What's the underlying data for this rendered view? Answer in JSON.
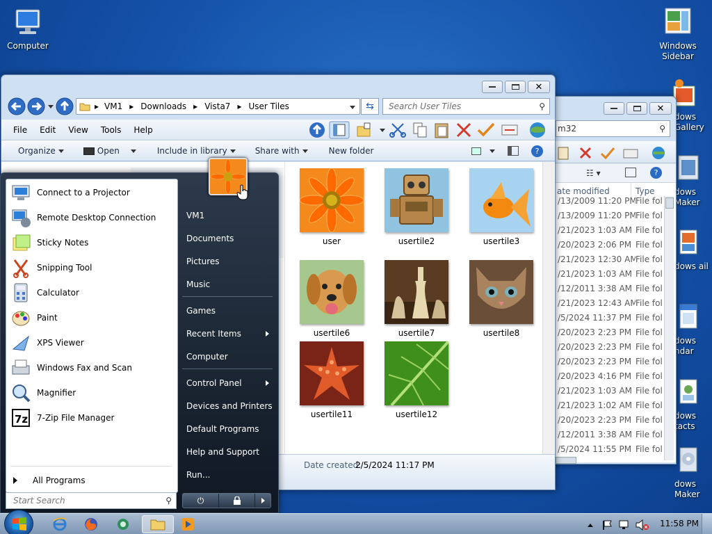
{
  "desktop": {
    "icons": [
      {
        "label": "Computer"
      },
      {
        "label": "Windows Sidebar"
      },
      {
        "label": "dows Gallery"
      },
      {
        "label": "dows Maker"
      },
      {
        "label": "dows ail"
      },
      {
        "label": "dows ndar"
      },
      {
        "label": "dows tacts"
      },
      {
        "label": "dows Maker"
      }
    ]
  },
  "back_window": {
    "address_fragment": "m32",
    "columns": [
      "ate modified",
      "Type"
    ],
    "rows": [
      {
        "date": "/13/2009 11:20 PM",
        "type": "File fol"
      },
      {
        "date": "/13/2009 11:20 PM",
        "type": "File fol"
      },
      {
        "date": "/21/2023 1:03 AM",
        "type": "File fol"
      },
      {
        "date": "/20/2023 2:06 PM",
        "type": "File fol"
      },
      {
        "date": "/21/2023 12:30 AM",
        "type": "File fol"
      },
      {
        "date": "/21/2023 1:03 AM",
        "type": "File fol"
      },
      {
        "date": "/12/2011 3:38 AM",
        "type": "File fol"
      },
      {
        "date": "/21/2023 12:43 AM",
        "type": "File fol"
      },
      {
        "date": "/5/2024 11:37 PM",
        "type": "File fol"
      },
      {
        "date": "/20/2023 2:23 PM",
        "type": "File fol"
      },
      {
        "date": "/20/2023 2:23 PM",
        "type": "File fol"
      },
      {
        "date": "/20/2023 2:23 PM",
        "type": "File fol"
      },
      {
        "date": "/20/2023 4:16 PM",
        "type": "File fol"
      },
      {
        "date": "/21/2023 1:03 AM",
        "type": "File fol"
      },
      {
        "date": "/21/2023 1:02 AM",
        "type": "File fol"
      },
      {
        "date": "/20/2023 2:23 PM",
        "type": "File fol"
      },
      {
        "date": "/12/2011 3:38 AM",
        "type": "File fol"
      },
      {
        "date": "/5/2024 11:55 PM",
        "type": "File fol"
      }
    ]
  },
  "explorer": {
    "breadcrumb": [
      "VM1",
      "Downloads",
      "Vista7",
      "User Tiles"
    ],
    "search_placeholder": "Search User Tiles",
    "menu": [
      "File",
      "Edit",
      "View",
      "Tools",
      "Help"
    ],
    "commands": {
      "organize": "Organize",
      "open": "Open",
      "include": "Include in library",
      "share": "Share with",
      "new_folder": "New folder"
    },
    "tiles": [
      {
        "name": "user",
        "icon": "orange-flower-image"
      },
      {
        "name": "usertile2",
        "icon": "robot-toy-image"
      },
      {
        "name": "usertile3",
        "icon": "goldfish-image"
      },
      {
        "name": "usertile6",
        "icon": "puppy-image"
      },
      {
        "name": "usertile7",
        "icon": "chess-pieces-image"
      },
      {
        "name": "usertile8",
        "icon": "kitten-image"
      },
      {
        "name": "usertile11",
        "icon": "starfish-image"
      },
      {
        "name": "usertile12",
        "icon": "green-leaf-image"
      }
    ],
    "details": {
      "label": "Date created:",
      "value": "2/5/2024 11:17 PM"
    }
  },
  "start_menu": {
    "programs": [
      {
        "label": "Connect to a Projector",
        "icon": "projector-icon"
      },
      {
        "label": "Remote Desktop Connection",
        "icon": "remote-desktop-icon"
      },
      {
        "label": "Sticky Notes",
        "icon": "sticky-notes-icon"
      },
      {
        "label": "Snipping Tool",
        "icon": "snipping-tool-icon"
      },
      {
        "label": "Calculator",
        "icon": "calculator-icon"
      },
      {
        "label": "Paint",
        "icon": "paint-icon"
      },
      {
        "label": "XPS Viewer",
        "icon": "xps-viewer-icon"
      },
      {
        "label": "Windows Fax and Scan",
        "icon": "fax-scan-icon"
      },
      {
        "label": "Magnifier",
        "icon": "magnifier-icon"
      },
      {
        "label": "7-Zip File Manager",
        "icon": "7zip-icon"
      }
    ],
    "all_programs": "All Programs",
    "search_placeholder": "Start Search",
    "right_items": [
      "VM1",
      "Documents",
      "Pictures",
      "Music",
      "Games",
      "Recent Items",
      "Computer",
      "Control Panel",
      "Devices and Printers",
      "Default Programs",
      "Help and Support",
      "Run..."
    ]
  },
  "taskbar": {
    "clock": "11:58 PM"
  },
  "colors": {
    "accent": "#1553ab",
    "selection": "#cde8ff"
  }
}
